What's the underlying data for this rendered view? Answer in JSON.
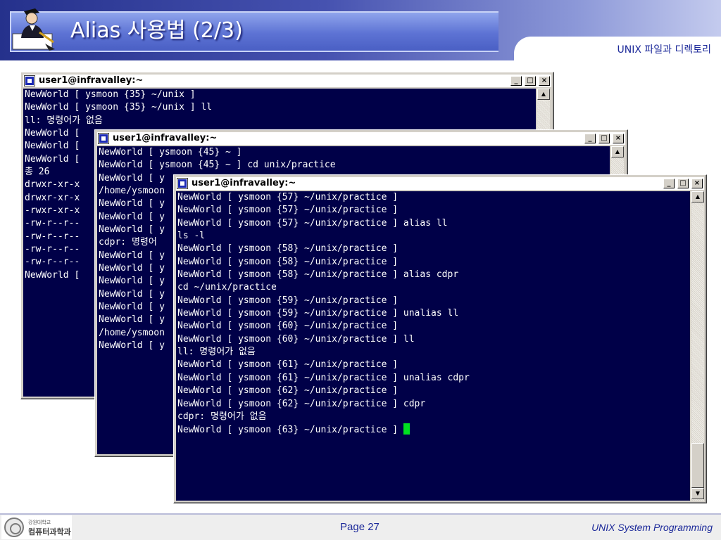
{
  "slide": {
    "title": "Alias 사용법 (2/3)",
    "subtitle": "UNIX 파일과 디렉토리"
  },
  "windows": [
    {
      "title": "user1@infravalley:~",
      "controls": [
        "_",
        "□",
        "×"
      ],
      "lines": [
        "NewWorld [ ysmoon {35} ~/unix ]",
        "NewWorld [ ysmoon {35} ~/unix ] ll",
        "ll: 명령어가 없음",
        "NewWorld [",
        "NewWorld [",
        "NewWorld [",
        "총 26",
        "drwxr-xr-x",
        "drwxr-xr-x",
        "-rwxr-xr-x",
        "-rw-r--r--",
        "-rw-r--r--",
        "-rw-r--r--",
        "-rw-r--r--",
        "NewWorld ["
      ]
    },
    {
      "title": "user1@infravalley:~",
      "controls": [
        "_",
        "□",
        "×"
      ],
      "lines": [
        "NewWorld [ ysmoon {45} ~ ]",
        "NewWorld [ ysmoon {45} ~ ] cd unix/practice",
        "NewWorld [ y",
        "/home/ysmoon",
        "NewWorld [ y",
        "NewWorld [ y",
        "NewWorld [ y",
        "cdpr: 명령어",
        "NewWorld [ y",
        "NewWorld [ y",
        "NewWorld [ y",
        "NewWorld [ y",
        "NewWorld [ y",
        "NewWorld [ y",
        "/home/ysmoon",
        "NewWorld [ y"
      ]
    },
    {
      "title": "user1@infravalley:~",
      "controls": [
        "_",
        "□",
        "×"
      ],
      "lines": [
        "NewWorld [ ysmoon {57} ~/unix/practice ]",
        "NewWorld [ ysmoon {57} ~/unix/practice ]",
        "NewWorld [ ysmoon {57} ~/unix/practice ] alias ll",
        "ls -l",
        "NewWorld [ ysmoon {58} ~/unix/practice ]",
        "NewWorld [ ysmoon {58} ~/unix/practice ]",
        "NewWorld [ ysmoon {58} ~/unix/practice ] alias cdpr",
        "cd ~/unix/practice",
        "NewWorld [ ysmoon {59} ~/unix/practice ]",
        "NewWorld [ ysmoon {59} ~/unix/practice ] unalias ll",
        "NewWorld [ ysmoon {60} ~/unix/practice ]",
        "NewWorld [ ysmoon {60} ~/unix/practice ] ll",
        "ll: 명령어가 없음",
        "NewWorld [ ysmoon {61} ~/unix/practice ]",
        "NewWorld [ ysmoon {61} ~/unix/practice ] unalias cdpr",
        "NewWorld [ ysmoon {62} ~/unix/practice ]",
        "NewWorld [ ysmoon {62} ~/unix/practice ] cdpr",
        "cdpr: 명령어가 없음",
        "NewWorld [ ysmoon {63} ~/unix/practice ] "
      ]
    }
  ],
  "footer": {
    "logo_small": "강원대학교",
    "logo_big": "컴퓨터과학과",
    "page": "Page 27",
    "course": "UNIX System Programming"
  },
  "colors": {
    "terminal_bg": "#000048",
    "terminal_fg": "#ffffff",
    "cursor": "#00e020",
    "accent": "#1d2a9a"
  },
  "icons": [
    "professor-mascot-icon",
    "terminal-app-icon",
    "minimize-icon",
    "maximize-icon",
    "close-icon",
    "scroll-up-icon",
    "scroll-down-icon",
    "university-seal-icon"
  ]
}
